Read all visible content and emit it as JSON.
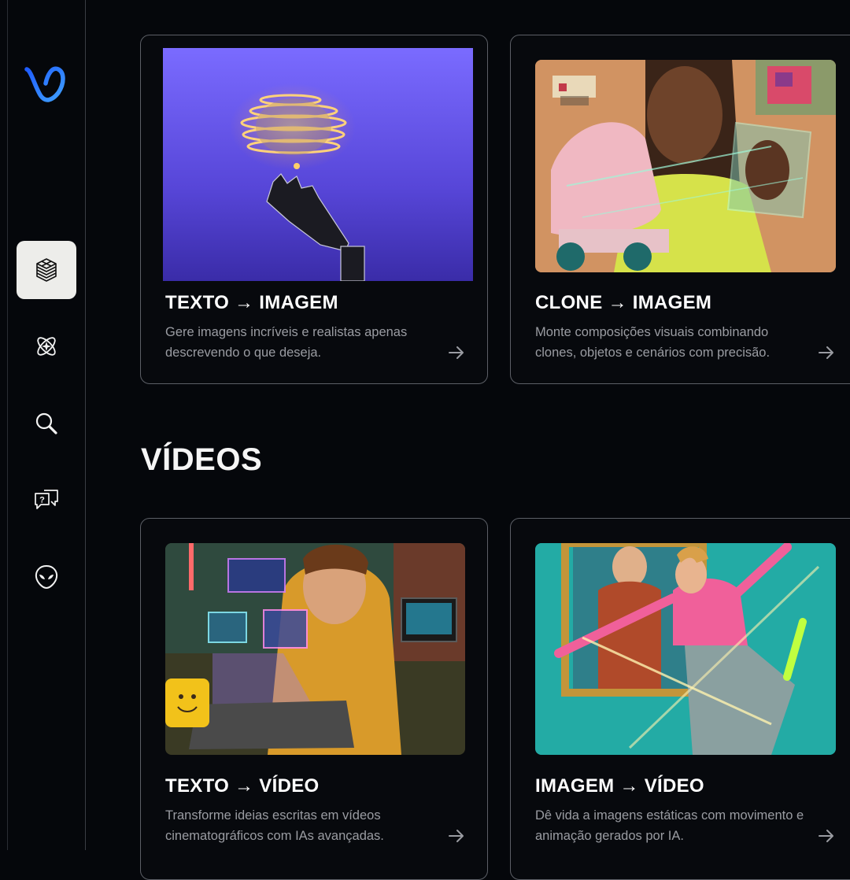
{
  "sidebar": {
    "logo": "brand-logo",
    "items": [
      {
        "icon": "layers-cube-icon",
        "active": true
      },
      {
        "icon": "atom-sparkle-icon",
        "active": false
      },
      {
        "icon": "search-icon",
        "active": false
      },
      {
        "icon": "chat-question-icon",
        "active": false
      },
      {
        "icon": "alien-icon",
        "active": false
      }
    ]
  },
  "images_section": {
    "cards": [
      {
        "title": "TEXTO → IMAGEM",
        "description": "Gere imagens incríveis e realistas apenas descrevendo o que deseja.",
        "arrow": "arrow-right-icon"
      },
      {
        "title": "CLONE → IMAGEM",
        "description": "Monte composições visuais combinando clones, objetos e cenários com precisão.",
        "arrow": "arrow-right-icon"
      }
    ]
  },
  "videos_section": {
    "title": "VÍDEOS",
    "cards": [
      {
        "title": "TEXTO → VÍDEO",
        "description": "Transforme ideias escritas em vídeos cinematográficos com IAs avançadas.",
        "arrow": "arrow-right-icon"
      },
      {
        "title": "IMAGEM → VÍDEO",
        "description": "Dê vida a imagens estáticas com movimento e animação gerados por IA.",
        "arrow": "arrow-right-icon"
      }
    ]
  },
  "colors": {
    "background": "#05070b",
    "card_border": "#5c5f66",
    "active_nav": "#ededea",
    "logo_gradient": [
      "#1f6bff",
      "#3b8cff"
    ]
  }
}
